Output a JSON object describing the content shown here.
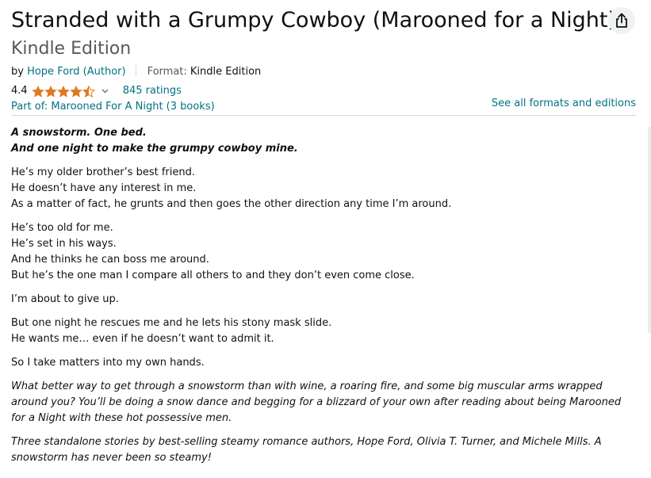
{
  "product": {
    "title": "Stranded with a Grumpy Cowboy (Marooned for a Night)",
    "edition": "Kindle Edition",
    "by_prefix": "by ",
    "author": "Hope Ford",
    "author_role": " (Author)",
    "format_label": "Format: ",
    "format_value": "Kindle Edition",
    "rating_value": "4.4",
    "rating_fraction": 0.88,
    "ratings_count": "845 ratings",
    "series_text": "Part of: Marooned For A Night (3 books)",
    "formats_link": "See all formats and editions"
  },
  "icons": {
    "share": "share-icon",
    "star": "star-icon",
    "chevron": "chevron-down-icon"
  },
  "colors": {
    "link": "#007185",
    "star": "#de7921",
    "muted": "#565959"
  },
  "description": {
    "tagline_1": "A snowstorm. One bed.",
    "tagline_2": "And one night to make the grumpy cowboy mine.",
    "p1_l1": "He’s my older brother’s best friend.",
    "p1_l2": "He doesn’t have any interest in me.",
    "p1_l3": "As a matter of fact, he grunts and then goes the other direction any time I’m around.",
    "p2_l1": "He’s too old for me.",
    "p2_l2": "He’s set in his ways.",
    "p2_l3": "And he thinks he can boss me around.",
    "p2_l4": "But he’s the one man I compare all others to and they don’t even come close.",
    "p3": "I’m about to give up.",
    "p4_l1": "But one night he rescues me and he lets his stony mask slide.",
    "p4_l2": "He wants me… even if he doesn’t want to admit it.",
    "p5": "So I take matters into my own hands.",
    "p6": "What better way to get through a snowstorm than with wine, a roaring fire, and some big muscular arms wrapped around you? You’ll be doing a snow dance and begging for a blizzard of your own after reading about being Marooned for a Night with these hot possessive men.",
    "p7": "Three standalone stories by best-selling steamy romance authors, Hope Ford, Olivia T. Turner, and Michele Mills. A snowstorm has never been so steamy!"
  }
}
